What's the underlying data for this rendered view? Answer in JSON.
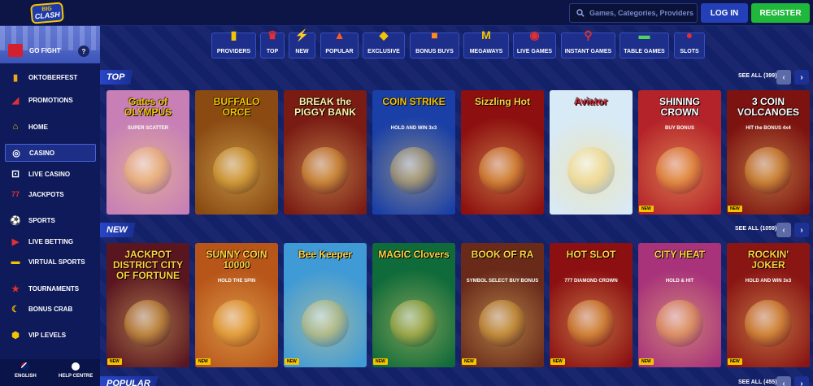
{
  "header": {
    "logo_top": "BIG",
    "logo_bottom": "CLASH",
    "search_placeholder": "Games, Categories, Providers",
    "login_label": "LOG IN",
    "register_label": "REGISTER"
  },
  "sidebar": {
    "promo_label": "GO FIGHT",
    "help_label": "?",
    "items": [
      {
        "label": "OKTOBERFEST",
        "icon": "beer-icon"
      },
      {
        "label": "PROMOTIONS",
        "icon": "megaphone-icon"
      },
      {
        "label": "HOME",
        "icon": "home-icon"
      },
      {
        "label": "CASINO",
        "icon": "roulette-icon"
      },
      {
        "label": "LIVE CASINO",
        "icon": "dice-icon"
      },
      {
        "label": "JACKPOTS",
        "icon": "sevens-icon"
      },
      {
        "label": "SPORTS",
        "icon": "soccer-ball-icon"
      },
      {
        "label": "LIVE BETTING",
        "icon": "play-circle-icon"
      },
      {
        "label": "VIRTUAL SPORTS",
        "icon": "stadium-icon"
      },
      {
        "label": "TOURNAMENTS",
        "icon": "trophy-icon"
      },
      {
        "label": "BONUS CRAB",
        "icon": "crab-icon"
      },
      {
        "label": "VIP LEVELS",
        "icon": "vip-hexagon-icon"
      }
    ],
    "footer": {
      "language": "ENGLISH",
      "help": "HELP CENTRE"
    }
  },
  "categories": [
    {
      "label": "PROVIDERS",
      "icon": "bar-icon"
    },
    {
      "label": "TOP",
      "icon": "crown-icon"
    },
    {
      "label": "NEW",
      "icon": "lightning-icon"
    },
    {
      "label": "POPULAR",
      "icon": "fire-icon"
    },
    {
      "label": "EXCLUSIVE",
      "icon": "gem-icon"
    },
    {
      "label": "BONUS BUYS",
      "icon": "gift-icon"
    },
    {
      "label": "MEGAWAYS",
      "icon": "m-icon"
    },
    {
      "label": "LIVE GAMES",
      "icon": "chip-icon"
    },
    {
      "label": "INSTANT GAMES",
      "icon": "joystick-icon"
    },
    {
      "label": "TABLE GAMES",
      "icon": "table-icon"
    },
    {
      "label": "SLOTS",
      "icon": "cherries-icon"
    }
  ],
  "sections": [
    {
      "title": "TOP",
      "see_all": "SEE ALL (399)",
      "games": [
        {
          "name": "Gates of OLYMPUS",
          "sub": "SUPER SCATTER",
          "bg": "#c77fb6",
          "badge": ""
        },
        {
          "name": "BUFFALO ORCE",
          "sub": "",
          "bg": "#8a4a12",
          "badge": ""
        },
        {
          "name": "BREAK the PIGGY BANK",
          "sub": "",
          "bg": "#7a1b14",
          "badge": ""
        },
        {
          "name": "COIN STRIKE",
          "sub": "HOLD AND WIN 3x3",
          "bg": "#1a3fa6",
          "badge": ""
        },
        {
          "name": "Sizzling Hot",
          "sub": "",
          "bg": "#8d0f0f",
          "badge": ""
        },
        {
          "name": "Aviator",
          "sub": "",
          "bg": "#d8eaf6",
          "badge": ""
        },
        {
          "name": "SHINING CROWN",
          "sub": "BUY BONUS",
          "bg": "#b5232a",
          "badge": "NEW"
        },
        {
          "name": "3 COIN VOLCANOES",
          "sub": "HIT the BONUS 4x4",
          "bg": "#7d1310",
          "badge": "NEW"
        }
      ]
    },
    {
      "title": "NEW",
      "see_all": "SEE ALL (1059)",
      "games": [
        {
          "name": "JACKPOT DISTRICT CITY OF FORTUNE",
          "sub": "",
          "bg": "#5a1620",
          "badge": "NEW"
        },
        {
          "name": "SUNNY COIN 10000",
          "sub": "HOLD THE SPIN",
          "bg": "#b8561a",
          "badge": "NEW"
        },
        {
          "name": "Bee Keeper",
          "sub": "",
          "bg": "#3f9ad6",
          "badge": "NEW"
        },
        {
          "name": "MAGIC Clovers",
          "sub": "",
          "bg": "#0f6b3a",
          "badge": "NEW"
        },
        {
          "name": "BOOK OF RA",
          "sub": "SYMBOL SELECT BUY BONUS",
          "bg": "#6a2a1a",
          "badge": "NEW"
        },
        {
          "name": "HOT SLOT",
          "sub": "777 DIAMOND CROWN",
          "bg": "#8c1012",
          "badge": "NEW"
        },
        {
          "name": "CITY HEAT",
          "sub": "HOLD & HIT",
          "bg": "#a8337a",
          "badge": "NEW"
        },
        {
          "name": "ROCKIN' JOKER",
          "sub": "HOLD AND WIN 3x3",
          "bg": "#8a1614",
          "badge": "NEW"
        }
      ]
    },
    {
      "title": "POPULAR",
      "see_all": "SEE ALL (455)",
      "games": []
    }
  ],
  "colors": {
    "accent": "#2340b8",
    "register": "#1fb83a",
    "badge": "#f5c400"
  }
}
